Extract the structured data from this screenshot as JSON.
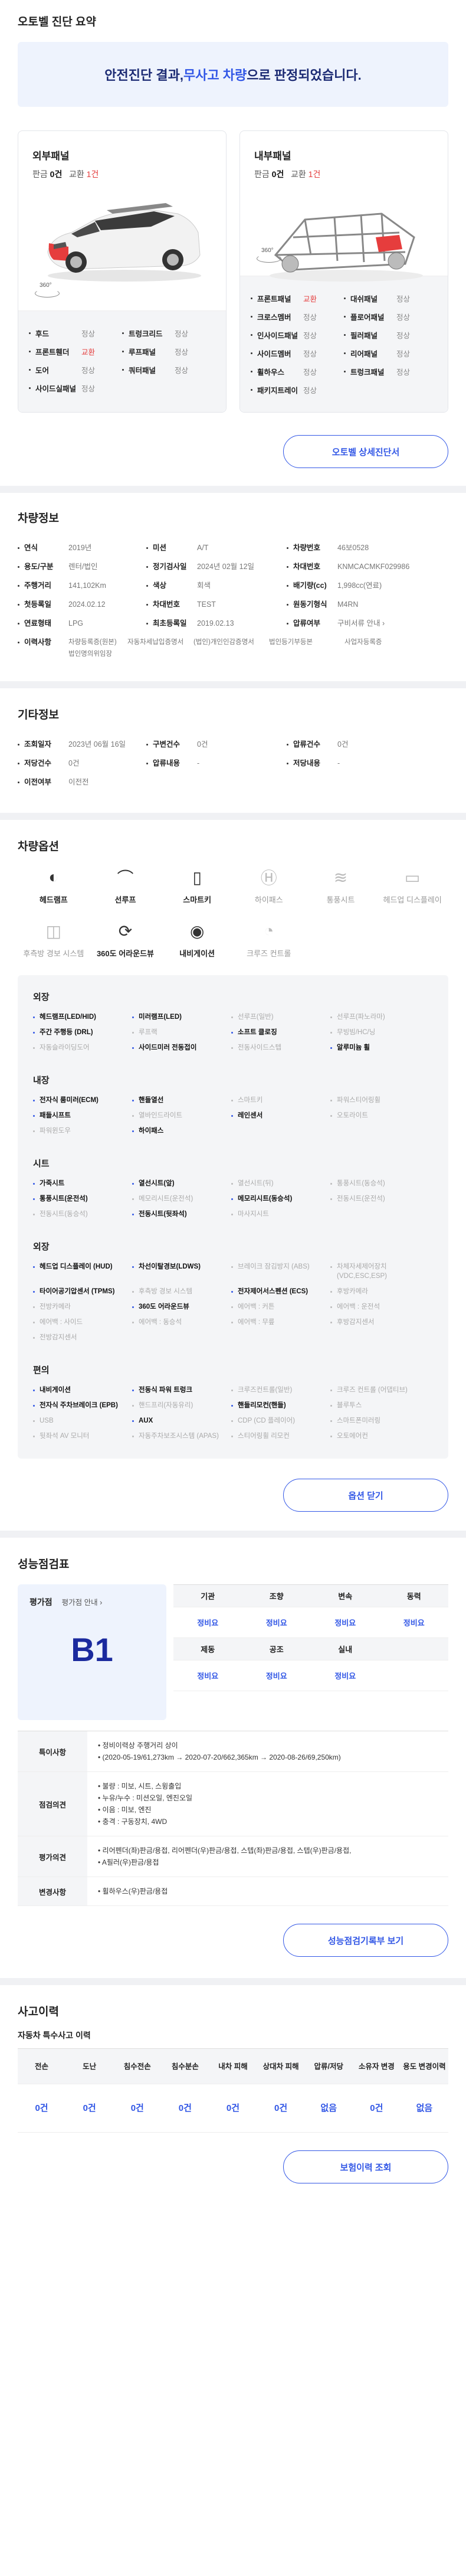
{
  "summary": {
    "title": "오토벨 진단 요약",
    "banner_pre": "안전진단 결과, ",
    "banner_hl": "무사고 차량",
    "banner_post": "으로 판정되었습니다.",
    "outer": {
      "name": "외부패널",
      "repair_label": "판금",
      "repair_count": "0건",
      "replace_label": "교환",
      "replace_count": "1건",
      "items": [
        {
          "n": "후드",
          "s": "정상"
        },
        {
          "n": "트렁크리드",
          "s": "정상"
        },
        {
          "n": "프론트휀더",
          "s": "교환"
        },
        {
          "n": "루프패널",
          "s": "정상"
        },
        {
          "n": "도어",
          "s": "정상"
        },
        {
          "n": "쿼터패널",
          "s": "정상"
        },
        {
          "n": "사이드실패널",
          "s": "정상"
        }
      ]
    },
    "inner": {
      "name": "내부패널",
      "repair_label": "판금",
      "repair_count": "0건",
      "replace_label": "교환",
      "replace_count": "1건",
      "items": [
        {
          "n": "프론트패널",
          "s": "교환"
        },
        {
          "n": "대쉬패널",
          "s": "정상"
        },
        {
          "n": "크로스멤버",
          "s": "정상"
        },
        {
          "n": "플로어패널",
          "s": "정상"
        },
        {
          "n": "인사이드패널",
          "s": "정상"
        },
        {
          "n": "필러패널",
          "s": "정상"
        },
        {
          "n": "사이드멤버",
          "s": "정상"
        },
        {
          "n": "리어패널",
          "s": "정상"
        },
        {
          "n": "휠하우스",
          "s": "정상"
        },
        {
          "n": "트렁크패널",
          "s": "정상"
        },
        {
          "n": "패키지트레이",
          "s": "정상"
        }
      ]
    },
    "rotate_label": "360°",
    "detail_button": "오토벨 상세진단서"
  },
  "carinfo": {
    "title": "차량정보",
    "rows": [
      [
        {
          "k": "연식",
          "v": "2019년"
        },
        {
          "k": "미션",
          "v": "A/T"
        },
        {
          "k": "차량번호",
          "v": "46보0528"
        }
      ],
      [
        {
          "k": "용도/구분",
          "v": "렌터/법인"
        },
        {
          "k": "정기검사일",
          "v": "2024년 02월 12일"
        },
        {
          "k": "차대번호",
          "v": "KNMCACMKF029986"
        }
      ],
      [
        {
          "k": "주행거리",
          "v": "141,102Km"
        },
        {
          "k": "색상",
          "v": "회색"
        },
        {
          "k": "배기량(cc)",
          "v": "1,998cc(연료)"
        }
      ],
      [
        {
          "k": "첫등록일",
          "v": "2024.02.12"
        },
        {
          "k": "차대번호",
          "v": "TEST"
        },
        {
          "k": "원동기형식",
          "v": "M4RN"
        }
      ],
      [
        {
          "k": "연료형태",
          "v": "LPG"
        },
        {
          "k": "최초등록일",
          "v": "2019.02.13"
        },
        {
          "k": "압류여부",
          "v": "구비서류 안내 ›"
        }
      ]
    ],
    "usage_label": "이력사항",
    "usage_vals": [
      "차량등록증(원본)",
      "자동차세납입증명서",
      "(법인)개인인감증명서",
      "법인등기부등본",
      "사업자등록증"
    ],
    "usage_extra": "법인명의위임장"
  },
  "other": {
    "title": "기타정보",
    "rows": [
      [
        {
          "k": "조회일자",
          "v": "2023년 06월 16일"
        },
        {
          "k": "구변건수",
          "v": "0건"
        },
        {
          "k": "압류건수",
          "v": "0건"
        }
      ],
      [
        {
          "k": "저당건수",
          "v": "0건"
        },
        {
          "k": "압류내용",
          "v": "-"
        },
        {
          "k": "저당내용",
          "v": "-"
        }
      ],
      [
        {
          "k": "이전여부",
          "v": "이전전"
        }
      ]
    ]
  },
  "options": {
    "title": "차량옵션",
    "icons": [
      {
        "label": "헤드램프",
        "on": true,
        "icon": "headlamp-icon"
      },
      {
        "label": "선루프",
        "on": true,
        "icon": "sunroof-icon"
      },
      {
        "label": "스마트키",
        "on": true,
        "icon": "smartkey-icon"
      },
      {
        "label": "하이패스",
        "on": false,
        "icon": "hipass-icon"
      },
      {
        "label": "통풍시트",
        "on": false,
        "icon": "ventilated-seat-icon"
      },
      {
        "label": "헤드업 디스플레이",
        "on": false,
        "icon": "hud-icon"
      },
      {
        "label": "후측방 경보 시스템",
        "on": false,
        "icon": "blind-spot-icon"
      },
      {
        "label": "360도 어라운드뷰",
        "on": true,
        "icon": "around-view-icon"
      },
      {
        "label": "내비게이션",
        "on": true,
        "icon": "navigation-icon"
      },
      {
        "label": "크루즈 컨트롤",
        "on": false,
        "icon": "cruise-icon"
      }
    ],
    "groups": [
      {
        "name": "외장",
        "items": [
          {
            "t": "헤드램프(LED/HID)",
            "on": true
          },
          {
            "t": "미러램프(LED)",
            "on": true
          },
          {
            "t": "선루프(일반)",
            "on": false
          },
          {
            "t": "선루프(파노라마)",
            "on": false
          },
          {
            "t": "주간 주행등 (DRL)",
            "on": true
          },
          {
            "t": "루프랙",
            "on": false
          },
          {
            "t": "소프트 클로징",
            "on": true
          },
          {
            "t": "무빙빔/HC/닝",
            "on": false
          },
          {
            "t": "자동슬라이딩도어",
            "on": false
          },
          {
            "t": "사이드미러 전동접이",
            "on": true
          },
          {
            "t": "전동사이드스텝",
            "on": false
          },
          {
            "t": "알루미늄 휠",
            "on": true
          }
        ]
      },
      {
        "name": "내장",
        "items": [
          {
            "t": "전자식 룸미러(ECM)",
            "on": true
          },
          {
            "t": "핸들열선",
            "on": true
          },
          {
            "t": "스마트키",
            "on": false
          },
          {
            "t": "파워스티어링휠",
            "on": false
          },
          {
            "t": "패들시프트",
            "on": true
          },
          {
            "t": "열바인드라이트",
            "on": false
          },
          {
            "t": "레인센서",
            "on": true
          },
          {
            "t": "오토라이트",
            "on": false
          },
          {
            "t": "파워윈도우",
            "on": false
          },
          {
            "t": "하이패스",
            "on": true
          }
        ]
      },
      {
        "name": "시트",
        "items": [
          {
            "t": "가죽시트",
            "on": true
          },
          {
            "t": "열선시트(앞)",
            "on": true
          },
          {
            "t": "열선시트(뒤)",
            "on": false
          },
          {
            "t": "통풍시트(동승석)",
            "on": false
          },
          {
            "t": "통풍시트(운전석)",
            "on": true
          },
          {
            "t": "메모리시트(운전석)",
            "on": false
          },
          {
            "t": "메모리시트(동승석)",
            "on": true
          },
          {
            "t": "전동시트(운전석)",
            "on": false
          },
          {
            "t": "전동시트(동승석)",
            "on": false
          },
          {
            "t": "전동시트(뒷좌석)",
            "on": true
          },
          {
            "t": "마사지시트",
            "on": false
          }
        ]
      },
      {
        "name": "외장",
        "items": [
          {
            "t": "헤드업 디스플레이 (HUD)",
            "on": true
          },
          {
            "t": "차선이탈경보(LDWS)",
            "on": true
          },
          {
            "t": "브레이크 잠김방지 (ABS)",
            "on": false
          },
          {
            "t": "차체자세제어장치 (VDC,ESC,ESP)",
            "on": false
          },
          {
            "t": "타이어공기압센서 (TPMS)",
            "on": true
          },
          {
            "t": "후측방 경보 시스템",
            "on": false
          },
          {
            "t": "전자제어서스펜션 (ECS)",
            "on": true
          },
          {
            "t": "후방카메라",
            "on": false
          },
          {
            "t": "전방카메라",
            "on": false
          },
          {
            "t": "360도 어라운드뷰",
            "on": true
          },
          {
            "t": "에어백 : 커튼",
            "on": false
          },
          {
            "t": "에어백 : 운전석",
            "on": false
          },
          {
            "t": "에어백 : 사이드",
            "on": false
          },
          {
            "t": "에어백 : 동승석",
            "on": false
          },
          {
            "t": "에어백 : 무릎",
            "on": false
          },
          {
            "t": "후방감지센서",
            "on": false
          },
          {
            "t": "전방감지센서",
            "on": false
          }
        ]
      },
      {
        "name": "편의",
        "items": [
          {
            "t": "내비게이션",
            "on": true
          },
          {
            "t": "전동식 파워 트렁크",
            "on": true
          },
          {
            "t": "크루즈컨트롤(일반)",
            "on": false
          },
          {
            "t": "크루즈 컨트롤 (어댑티브)",
            "on": false
          },
          {
            "t": "전자식 주차브레이크 (EPB)",
            "on": true
          },
          {
            "t": "핸드프리(자동유리)",
            "on": false
          },
          {
            "t": "핸들리모컨(핸들)",
            "on": true
          },
          {
            "t": "블루투스",
            "on": false
          },
          {
            "t": "USB",
            "on": false
          },
          {
            "t": "AUX",
            "on": true
          },
          {
            "t": "CDP (CD 플레이어)",
            "on": false
          },
          {
            "t": "스마트폰미러링",
            "on": false
          },
          {
            "t": "뒷좌석 AV 모니터",
            "on": false
          },
          {
            "t": "자동주차보조시스템 (APAS)",
            "on": false
          },
          {
            "t": "스티어링휠 리모컨",
            "on": false
          },
          {
            "t": "오토에어컨",
            "on": false
          }
        ]
      }
    ],
    "close_button": "옵션 닫기"
  },
  "performance": {
    "title": "성능점검표",
    "grade_label": "평가점",
    "grade_guide": "평가점 안내 ›",
    "grade": "B1",
    "table": [
      {
        "h": "기관",
        "v": "정비요"
      },
      {
        "h": "조향",
        "v": "정비요"
      },
      {
        "h": "변속",
        "v": "정비요"
      },
      {
        "h": "동력",
        "v": "정비요"
      },
      {
        "h": "제동",
        "v": "정비요"
      },
      {
        "h": "공조",
        "v": "정비요"
      },
      {
        "h": "실내",
        "v": "정비요"
      }
    ],
    "remarks": [
      {
        "k": "특이사항",
        "lines": [
          "정비이력상 주행거리 상이",
          "(2020-05-19/61,273km → 2020-07-20/662,365km → 2020-08-26/69,250km)"
        ]
      },
      {
        "k": "점검의견",
        "lines": [
          "불량 : 미보, 시트, 스윙출입",
          "누유/누수 : 미션오일, 엔진오일",
          "이음 : 미보, 엔진",
          "충격 : 구동장치, 4WD"
        ]
      },
      {
        "k": "평가의견",
        "lines": [
          "리어펜더(좌)판금/용접, 리어펜더(우)판금/용접, 스텝(좌)판금/용접, 스텝(우)판금/용접,",
          "A필러(우)판금/용접"
        ]
      },
      {
        "k": "변경사항",
        "lines": [
          "휠하우스(우)판금/용접"
        ]
      }
    ],
    "button": "성능점검기록부 보기"
  },
  "accident": {
    "title": "사고이력",
    "subtitle": "자동차 특수사고 이력",
    "headers": [
      "전손",
      "도난",
      "침수전손",
      "침수분손",
      "내차 피해",
      "상대차 피해",
      "압류/저당",
      "소유자 변경",
      "용도 변경이력"
    ],
    "values": [
      "0건",
      "0건",
      "0건",
      "0건",
      "0건",
      "0건",
      "없음",
      "0건",
      "없음"
    ],
    "button": "보험이력 조회"
  }
}
